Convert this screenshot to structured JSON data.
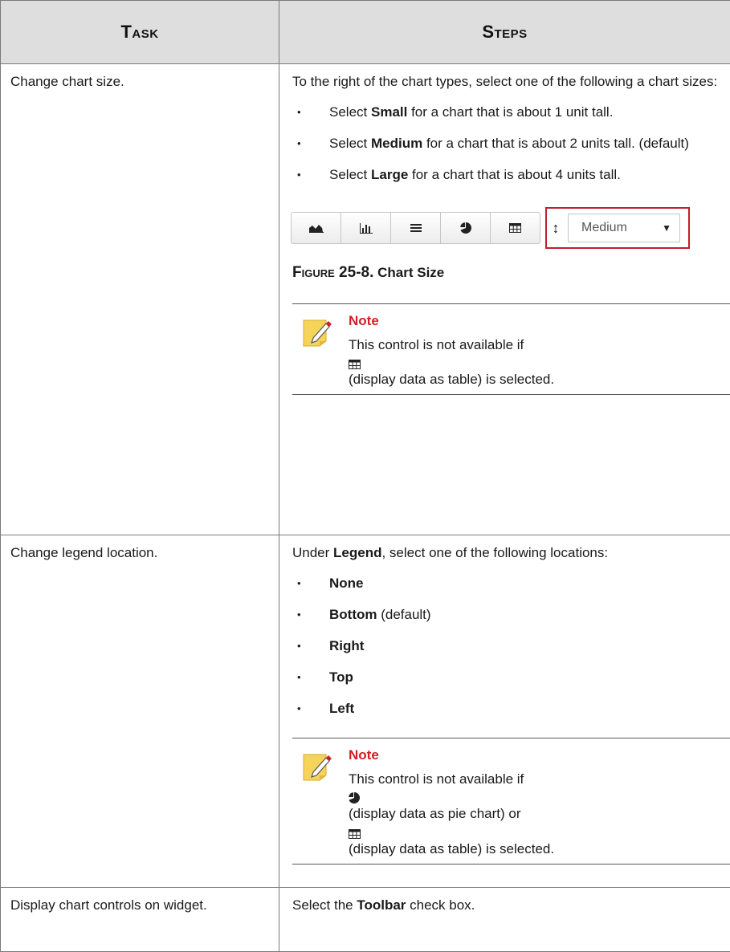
{
  "header": {
    "task": "Task",
    "steps": "Steps"
  },
  "rows": [
    {
      "task": "Change chart size.",
      "intro": "To the right of the chart types, select one of the following a chart sizes:",
      "bullets": [
        {
          "pre": "Select ",
          "bold": "Small",
          "post": " for a chart that is about 1 unit tall."
        },
        {
          "pre": "Select ",
          "bold": "Medium",
          "post": " for a chart that is about 2 units tall. (default)"
        },
        {
          "pre": "Select ",
          "bold": "Large",
          "post": " for a chart that is about 4 units tall."
        }
      ],
      "toolbar": {
        "buttons": [
          "area-chart-icon",
          "bar-chart-icon",
          "list-icon",
          "pie-chart-icon",
          "table-icon"
        ],
        "size_value": "Medium",
        "highlight_color": "#c0202a"
      },
      "figure": {
        "label": "Figure 25-8.",
        "title": "Chart Size"
      },
      "note": {
        "title": "Note",
        "line1": "This control is not available if",
        "line2": "(display data as table) is selected."
      }
    },
    {
      "task": "Change legend location.",
      "intro_pre": "Under ",
      "intro_bold": "Legend",
      "intro_post": ", select one of the following locations:",
      "options": [
        {
          "bold": "None",
          "post": ""
        },
        {
          "bold": "Bottom",
          "post": " (default)"
        },
        {
          "bold": "Right",
          "post": ""
        },
        {
          "bold": "Top",
          "post": ""
        },
        {
          "bold": "Left",
          "post": ""
        }
      ],
      "note": {
        "title": "Note",
        "line1": "This control is not available if",
        "line2": "(display data as pie chart) or",
        "line3": "(display data as table) is selected."
      }
    },
    {
      "task": "Display chart controls on widget.",
      "steps_pre": "Select the ",
      "steps_bold": "Toolbar",
      "steps_post": " check box."
    }
  ],
  "colors": {
    "header_bg": "#dedede",
    "note_title": "#d01f25",
    "border": "#7a7a7a"
  }
}
